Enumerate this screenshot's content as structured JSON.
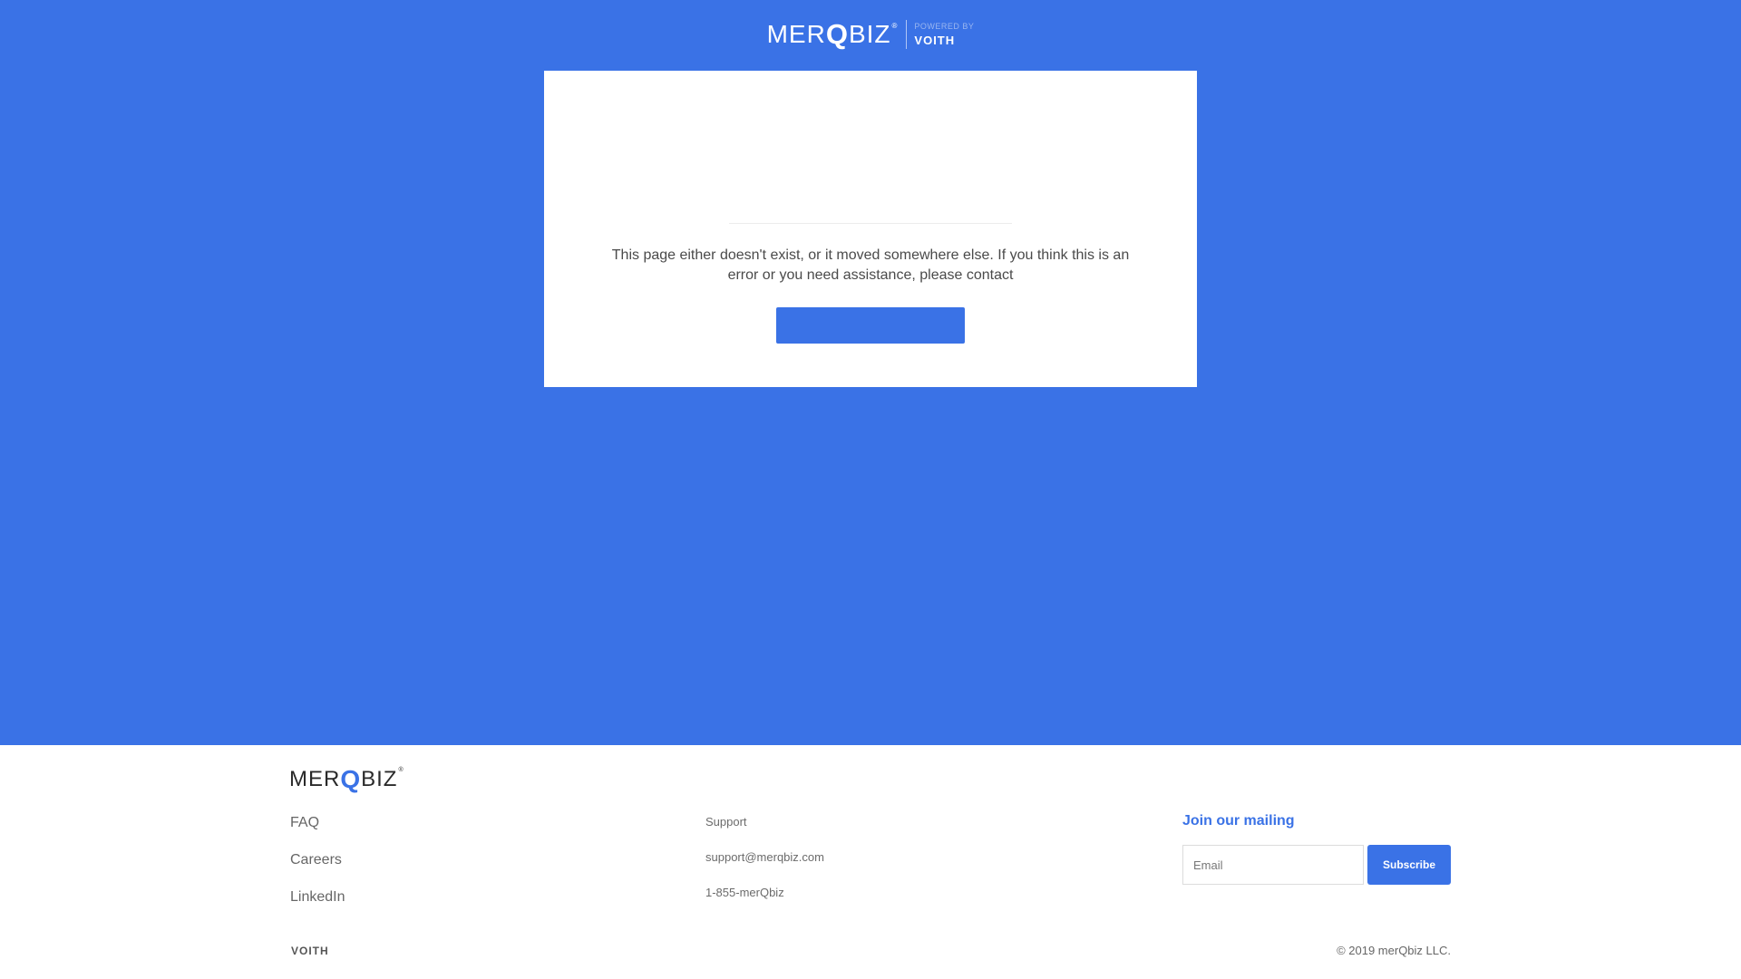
{
  "header": {
    "brand_prefix": "MER",
    "brand_q": "Q",
    "brand_suffix": "BIZ",
    "brand_reg": "®",
    "powered_by": "POWERED BY",
    "partner": "VOITH"
  },
  "card": {
    "message": "This page either doesn't exist, or it moved somewhere else. If you think this is an error or you need assistance, please contact",
    "button_label": ""
  },
  "footer": {
    "brand_prefix": "MER",
    "brand_q": "Q",
    "brand_suffix": "BIZ",
    "brand_reg": "®",
    "links": [
      "FAQ",
      "Careers",
      "LinkedIn"
    ],
    "support": {
      "title": "Support",
      "email": "support@merqbiz.com",
      "phone": "1-855-merQbiz"
    },
    "mailing": {
      "title": "Join our mailing",
      "placeholder": "Email",
      "subscribe_label": "Subscribe"
    },
    "partner": "VOITH",
    "copyright": "© 2019 merQbiz LLC."
  },
  "colors": {
    "brand_blue": "#3a72e6",
    "background_white": "#ffffff"
  }
}
